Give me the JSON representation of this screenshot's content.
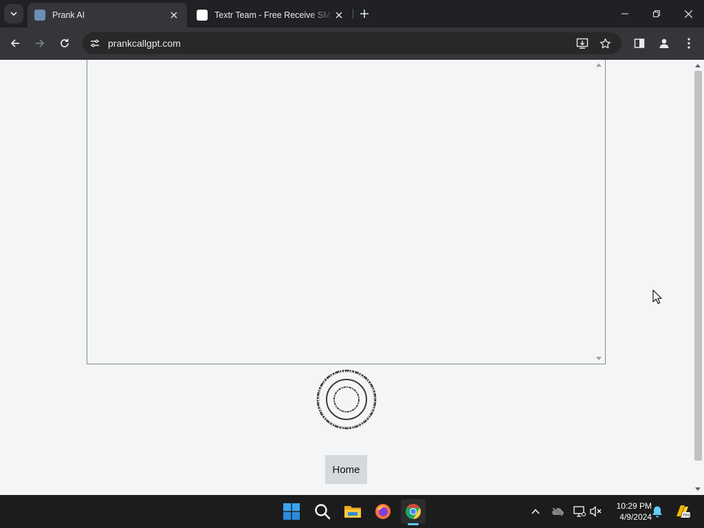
{
  "browser": {
    "tabs": [
      {
        "title": "Prank AI",
        "active": true,
        "favicon_color": "#6b8fb5"
      },
      {
        "title": "Textr Team - Free Receive SMS Online",
        "active": false,
        "favicon_color": "#ffffff"
      }
    ],
    "icons": {
      "tab_search": "chevron-down-icon",
      "new_tab": "plus-icon",
      "minimize": "minimize-icon",
      "restore": "restore-icon",
      "close": "close-icon",
      "back": "back-arrow-icon",
      "forward": "forward-arrow-icon",
      "reload": "reload-icon",
      "site_info": "tune-icon",
      "install_app": "install-app-icon",
      "bookmark": "star-icon",
      "side_panel": "side-panel-icon",
      "profile": "profile-icon",
      "menu": "kebab-menu-icon"
    },
    "address_bar": {
      "url": "prankcallgpt.com"
    }
  },
  "page": {
    "chat_log": {
      "text": ""
    },
    "home_button": {
      "label": "Home"
    }
  },
  "taskbar": {
    "apps": [
      {
        "name": "Start",
        "icon": "windows-start-icon"
      },
      {
        "name": "Search",
        "icon": "search-icon"
      },
      {
        "name": "File Explorer",
        "icon": "folder-icon"
      },
      {
        "name": "Firefox",
        "icon": "firefox-icon"
      },
      {
        "name": "Google Chrome",
        "icon": "chrome-icon",
        "active": true
      }
    ],
    "tray": {
      "icons": [
        "chevron-up-icon",
        "onedrive-icon",
        "network-icon",
        "volume-mute-icon",
        "notification-bell-icon",
        "copilot-icon"
      ],
      "time": "10:29 PM",
      "date": "4/9/2024"
    }
  },
  "colors": {
    "titlebar": "#202124",
    "toolbar": "#35363a",
    "page_background": "#f3f5f7",
    "button_background": "#d5d8dc",
    "taskbar": "#1c1c1c",
    "accent": "#60cdff"
  }
}
